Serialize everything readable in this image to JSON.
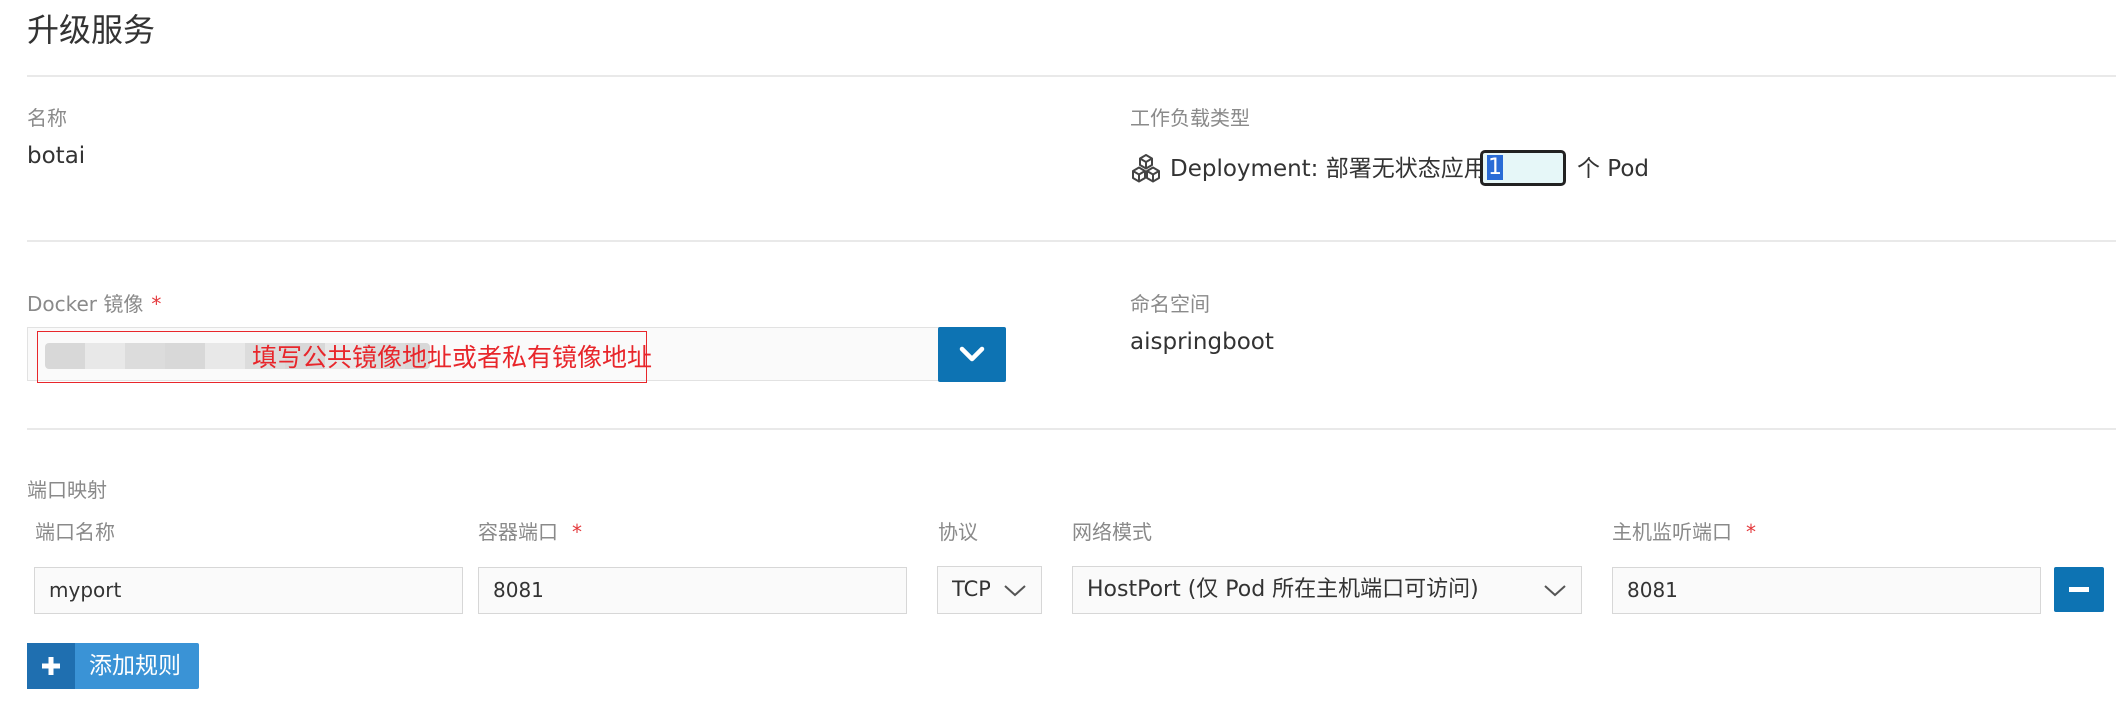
{
  "page": {
    "title": "升级服务"
  },
  "name_field": {
    "label": "名称",
    "value": "botai"
  },
  "workload": {
    "label": "工作负载类型",
    "type_text": "Deployment: 部署无状态应用",
    "pod_count": "1",
    "pod_suffix": "个 Pod",
    "icon": "cubes-icon"
  },
  "docker_image": {
    "label": "Docker 镜像",
    "required_mark": "*",
    "annotation": "填写公共镜像地址或者私有镜像地址",
    "annotation_color": "#e8262b"
  },
  "namespace": {
    "label": "命名空间",
    "value": "aispringboot"
  },
  "port_mapping": {
    "section_label": "端口映射",
    "headers": {
      "port_name": "端口名称",
      "container_port": "容器端口",
      "protocol": "协议",
      "network_mode": "网络模式",
      "host_port": "主机监听端口"
    },
    "required_mark": "*",
    "row": {
      "port_name": "myport",
      "container_port": "8081",
      "protocol": "TCP",
      "network_mode": "HostPort (仅 Pod 所在主机端口可访问)",
      "host_port": "8081"
    },
    "add_rule_label": "添加规则"
  },
  "colors": {
    "primary": "#0d73b3",
    "accent": "#3a93d6",
    "required": "#e4393c"
  }
}
